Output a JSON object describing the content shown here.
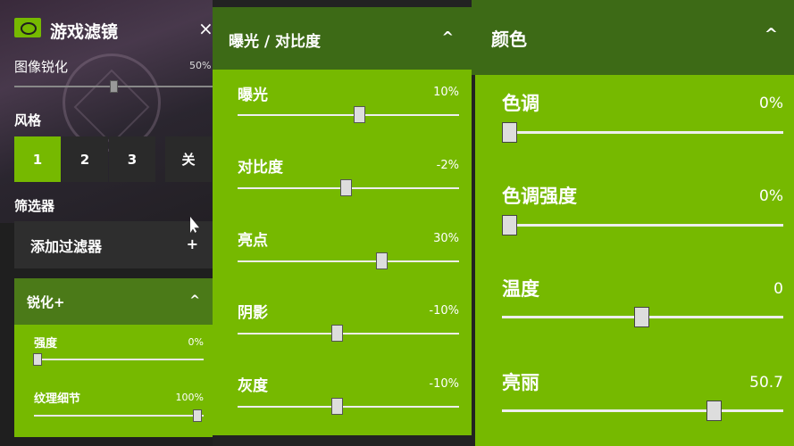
{
  "left": {
    "title": "游戏滤镜",
    "close": "×",
    "sharpen_label": "图像锐化",
    "sharpen_value": "50%",
    "sharpen_level": 0.5,
    "style_label": "风格",
    "style_buttons": [
      "1",
      "2",
      "3",
      "关"
    ],
    "style_selected": "1",
    "filter_label": "筛选器",
    "add_filter": "添加过滤器",
    "add_filter_icon": "+",
    "section": {
      "title": "锐化+",
      "chevron": "^",
      "params": [
        {
          "label": "强度",
          "value": "0%",
          "level": 0.0
        },
        {
          "label": "纹理细节",
          "value": "100%",
          "level": 1.0
        }
      ]
    }
  },
  "middle": {
    "title": "曝光 / 对比度",
    "chevron": "^",
    "params": [
      {
        "label": "曝光",
        "value": "10%",
        "level": 0.55
      },
      {
        "label": "对比度",
        "value": "-2%",
        "level": 0.49
      },
      {
        "label": "亮点",
        "value": "30%",
        "level": 0.65
      },
      {
        "label": "阴影",
        "value": "-10%",
        "level": 0.45
      },
      {
        "label": "灰度",
        "value": "-10%",
        "level": 0.45
      }
    ]
  },
  "right": {
    "title": "颜色",
    "chevron": "^",
    "params": [
      {
        "label": "色调",
        "value": "0%",
        "level": 0.0
      },
      {
        "label": "色调强度",
        "value": "0%",
        "level": 0.0
      },
      {
        "label": "温度",
        "value": "0",
        "level": 0.5
      },
      {
        "label": "亮丽",
        "value": "50.7",
        "level": 0.76
      }
    ]
  },
  "colors": {
    "accent": "#76b900",
    "header": "#3d6a16",
    "dark": "#1f1f1f"
  }
}
